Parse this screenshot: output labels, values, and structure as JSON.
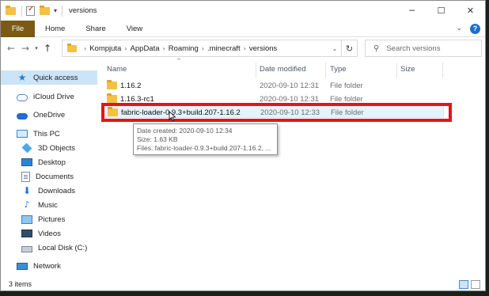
{
  "title": "versions",
  "ribbon": {
    "file": "File",
    "tabs": [
      "Home",
      "Share",
      "View"
    ]
  },
  "address": {
    "crumbs": [
      "Kompjuta",
      "AppData",
      "Roaming",
      ".minecraft",
      "versions"
    ],
    "search_placeholder": "Search versions"
  },
  "sidebar": {
    "items": [
      {
        "label": "Quick access",
        "icon": "star-icon"
      },
      {
        "label": "iCloud Drive",
        "icon": "cloud-icon"
      },
      {
        "label": "OneDrive",
        "icon": "onedrive-icon"
      },
      {
        "label": "This PC",
        "icon": "computer-icon"
      },
      {
        "label": "3D Objects",
        "icon": "cube-icon"
      },
      {
        "label": "Desktop",
        "icon": "desktop-icon"
      },
      {
        "label": "Documents",
        "icon": "document-icon"
      },
      {
        "label": "Downloads",
        "icon": "download-icon"
      },
      {
        "label": "Music",
        "icon": "music-icon"
      },
      {
        "label": "Pictures",
        "icon": "picture-icon"
      },
      {
        "label": "Videos",
        "icon": "video-icon"
      },
      {
        "label": "Local Disk (C:)",
        "icon": "disk-icon"
      },
      {
        "label": "Network",
        "icon": "network-icon"
      }
    ]
  },
  "columns": [
    "Name",
    "Date modified",
    "Type",
    "Size"
  ],
  "files": [
    {
      "name": "1.16.2",
      "date": "2020-09-10 12:31",
      "type": "File folder"
    },
    {
      "name": "1.16.3-rc1",
      "date": "2020-09-10 12:31",
      "type": "File folder"
    },
    {
      "name": "fabric-loader-0.9.3+build.207-1.16.2",
      "date": "2020-09-10 12:33",
      "type": "File folder"
    }
  ],
  "tooltip": {
    "created": "Date created: 2020-09-10 12:34",
    "size": "Size: 1.63 KB",
    "files": "Files: fabric-loader-0.9.3+build.207-1.16.2, ..."
  },
  "status": {
    "items": "3 items"
  },
  "colors": {
    "file_tab": "#7a5a16",
    "highlight": "#e2151c",
    "selection": "#cce4f7",
    "folder": "#f1c244"
  }
}
